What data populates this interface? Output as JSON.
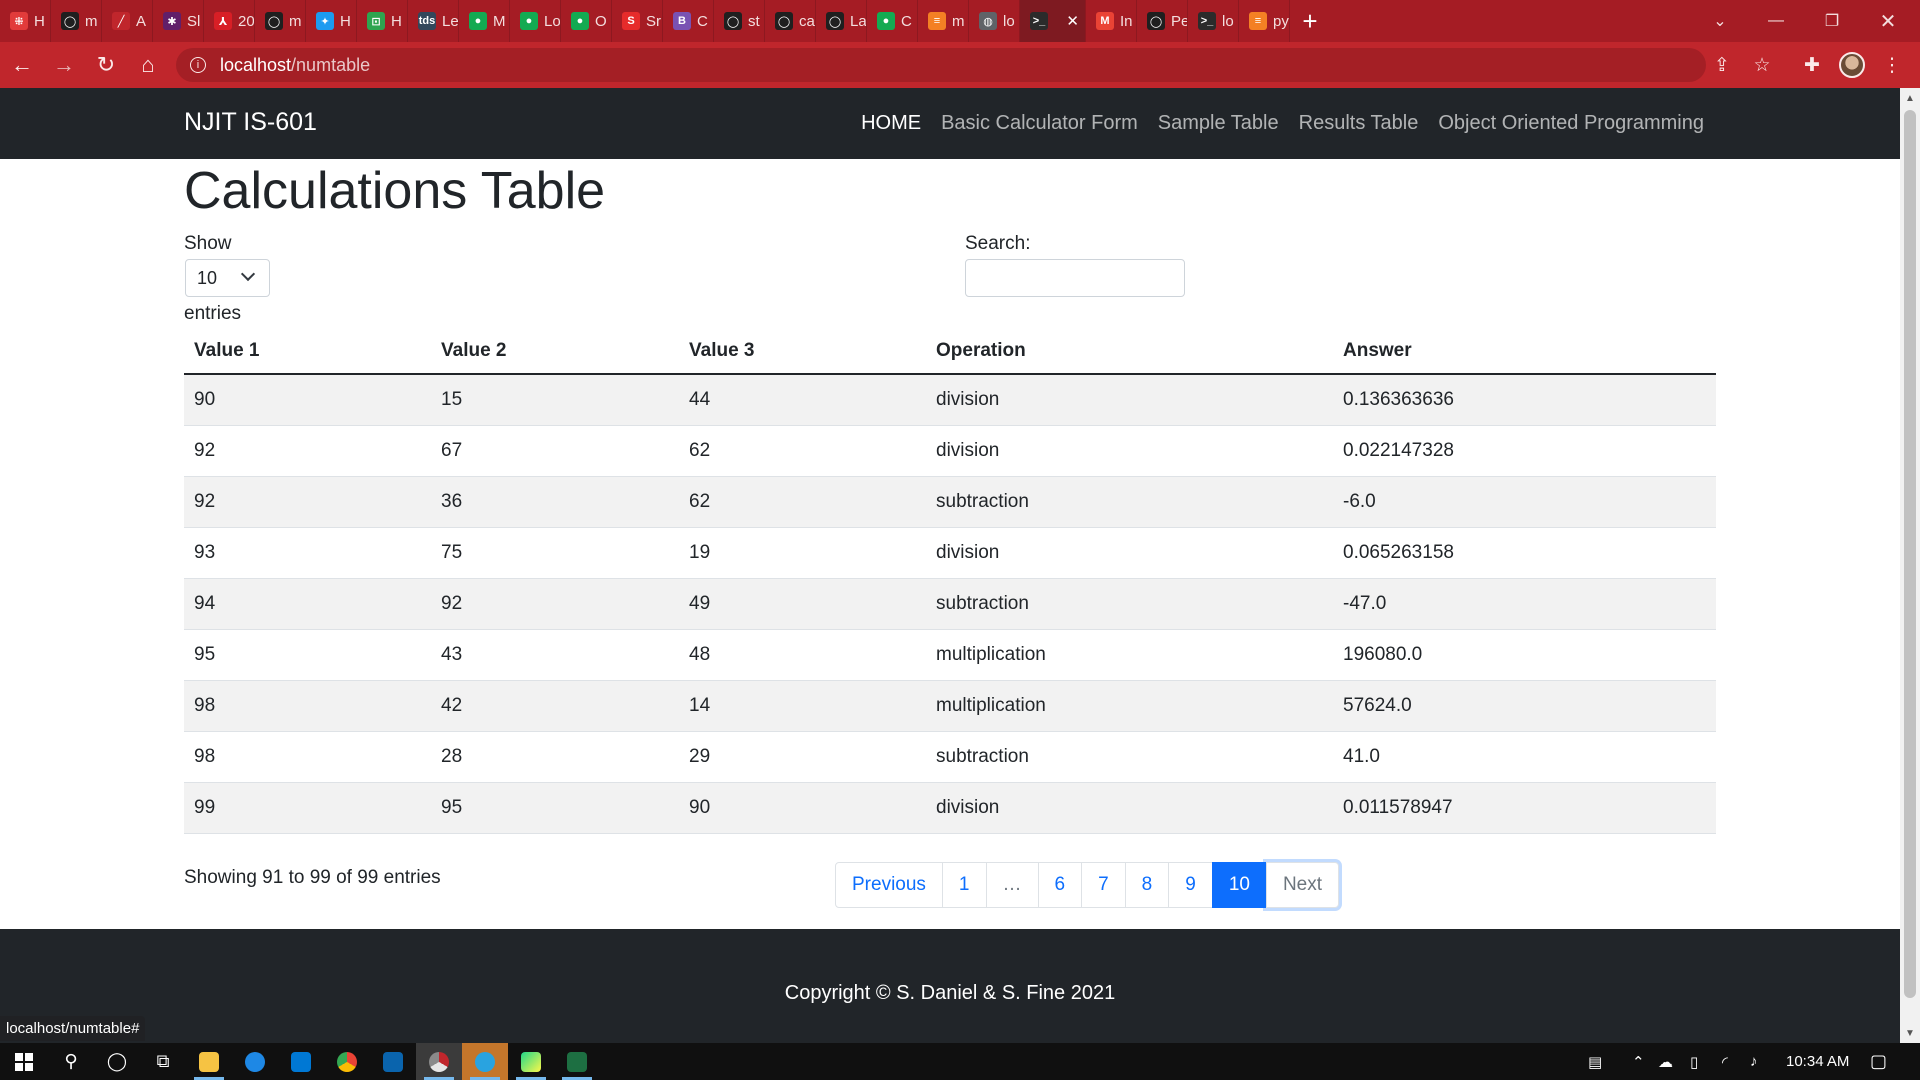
{
  "browser": {
    "tabs": [
      {
        "label": "H",
        "icon": "streamlit-icon",
        "color": "#e23b3b",
        "glyph": "⁜"
      },
      {
        "label": "m",
        "icon": "github-icon",
        "color": "#1f1f1f",
        "glyph": "◯"
      },
      {
        "label": "A",
        "icon": "pen-icon",
        "color": "#c0262c",
        "glyph": "╱"
      },
      {
        "label": "Sl",
        "icon": "slack-icon",
        "color": "#611f69",
        "glyph": "✱"
      },
      {
        "label": "20",
        "icon": "acrobat-icon",
        "color": "#d81f26",
        "glyph": "⅄"
      },
      {
        "label": "m",
        "icon": "github-icon",
        "color": "#1f1f1f",
        "glyph": "◯"
      },
      {
        "label": "H",
        "icon": "twitter-icon",
        "color": "#1d9bf0",
        "glyph": "✦"
      },
      {
        "label": "H",
        "icon": "hyperskill-icon",
        "color": "#2ea44f",
        "glyph": "⊡"
      },
      {
        "label": "Le",
        "icon": "tds-icon",
        "color": "#33475b",
        "glyph": "tds"
      },
      {
        "label": "M",
        "icon": "mongodb-icon",
        "color": "#13aa52",
        "glyph": "●"
      },
      {
        "label": "Lo",
        "icon": "mongodb-icon",
        "color": "#13aa52",
        "glyph": "●"
      },
      {
        "label": "O",
        "icon": "mongodb-icon",
        "color": "#13aa52",
        "glyph": "●"
      },
      {
        "label": "Sr",
        "icon": "scribd-icon",
        "color": "#e62b2b",
        "glyph": "S"
      },
      {
        "label": "C",
        "icon": "bootstrap-icon",
        "color": "#7952b3",
        "glyph": "B"
      },
      {
        "label": "st",
        "icon": "github-icon",
        "color": "#1f1f1f",
        "glyph": "◯"
      },
      {
        "label": "ca",
        "icon": "github-icon",
        "color": "#1f1f1f",
        "glyph": "◯"
      },
      {
        "label": "La",
        "icon": "github-icon",
        "color": "#1f1f1f",
        "glyph": "◯"
      },
      {
        "label": "C",
        "icon": "mongodb-icon",
        "color": "#13aa52",
        "glyph": "●"
      },
      {
        "label": "m",
        "icon": "stackoverflow-icon",
        "color": "#f48024",
        "glyph": "≡"
      },
      {
        "label": "lo",
        "icon": "globe-icon",
        "color": "#5f6368",
        "glyph": "◍"
      },
      {
        "label": "",
        "icon": "terminal-icon",
        "color": "#2b2b2b",
        "glyph": ">_",
        "active": true
      },
      {
        "label": "In",
        "icon": "gmail-icon",
        "color": "#ea4335",
        "glyph": "M"
      },
      {
        "label": "Pe",
        "icon": "github-icon",
        "color": "#1f1f1f",
        "glyph": "◯"
      },
      {
        "label": "lo",
        "icon": "terminal-icon",
        "color": "#2b2b2b",
        "glyph": ">_"
      },
      {
        "label": "py",
        "icon": "stackoverflow-icon",
        "color": "#f48024",
        "glyph": "≡"
      }
    ],
    "url_host": "localhost",
    "url_path": "/numtable",
    "status_url": "localhost/numtable#"
  },
  "navbar": {
    "brand": "NJIT IS-601",
    "links": [
      {
        "label": "HOME",
        "active": true
      },
      {
        "label": "Basic Calculator Form",
        "active": false
      },
      {
        "label": "Sample Table",
        "active": false
      },
      {
        "label": "Results Table",
        "active": false
      },
      {
        "label": "Object Oriented Programming",
        "active": false
      }
    ]
  },
  "page": {
    "title": "Calculations Table",
    "show_label": "Show",
    "entries_select": "10",
    "entries_label": "entries",
    "search_label": "Search:",
    "search_value": ""
  },
  "table": {
    "columns": [
      "Value 1",
      "Value 2",
      "Value 3",
      "Operation",
      "Answer"
    ],
    "rows": [
      [
        "90",
        "15",
        "44",
        "division",
        "0.136363636"
      ],
      [
        "92",
        "67",
        "62",
        "division",
        "0.022147328"
      ],
      [
        "92",
        "36",
        "62",
        "subtraction",
        "-6.0"
      ],
      [
        "93",
        "75",
        "19",
        "division",
        "0.065263158"
      ],
      [
        "94",
        "92",
        "49",
        "subtraction",
        "-47.0"
      ],
      [
        "95",
        "43",
        "48",
        "multiplication",
        "196080.0"
      ],
      [
        "98",
        "42",
        "14",
        "multiplication",
        "57624.0"
      ],
      [
        "98",
        "28",
        "29",
        "subtraction",
        "41.0"
      ],
      [
        "99",
        "95",
        "90",
        "division",
        "0.011578947"
      ]
    ]
  },
  "pagination": {
    "info": "Showing 91 to 99 of 99 entries",
    "previous": "Previous",
    "pages": [
      "1",
      "…",
      "6",
      "7",
      "8",
      "9",
      "10"
    ],
    "current": "10",
    "next": "Next"
  },
  "footer": {
    "copyright": "Copyright © S. Daniel & S. Fine 2021"
  },
  "taskbar": {
    "time": "10:34 AM"
  }
}
